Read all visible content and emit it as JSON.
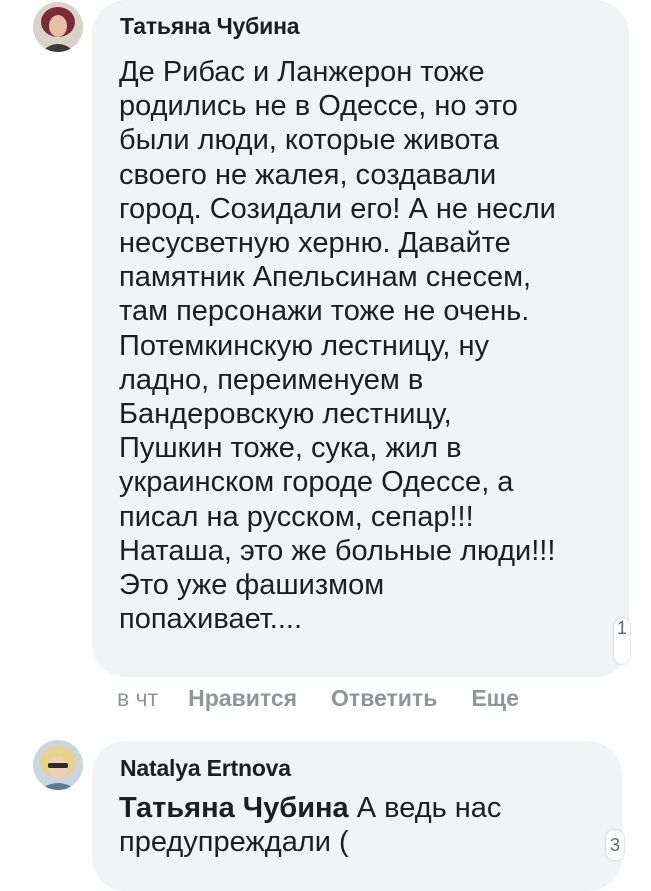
{
  "comments": [
    {
      "author": "Татьяна Чубина",
      "lines": [
        "Де Рибас и Ланжерон тоже",
        "родились не в Одессе, но это",
        "были люди, которые живота",
        "своего не жалея, создавали",
        "город. Созидали его! А не несли",
        "несусветную херню. Давайте",
        "памятник Апельсинам снесем,",
        "там персонажи тоже не очень.",
        "Потемкинскую лестницу, ну",
        "ладно, переименуем в",
        "Бандеровскую лестницу,",
        "Пушкин тоже, сука, жил в",
        "украинском городе Одессе, а",
        "писал на русском, сепар!!!",
        "Наташа, это же больные люди!!!",
        "Это уже фашизмом",
        "попахивает...."
      ],
      "badge": "1",
      "time": "в чт",
      "actions": {
        "like": "Нравится",
        "reply": "Ответить",
        "more": "Еще"
      }
    },
    {
      "author": "Natalya Ertnova",
      "mention": "Татьяна Чубина",
      "line1_rest": " А ведь нас",
      "line2": "предупреждали (",
      "badge": "3"
    }
  ]
}
